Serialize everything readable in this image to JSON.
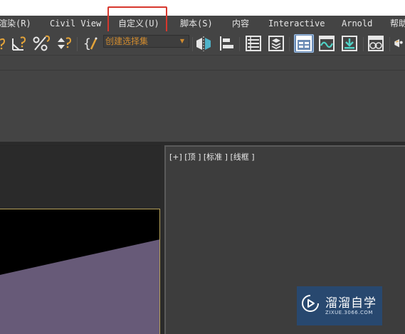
{
  "menubar": {
    "items": [
      {
        "label": "渲染(R)"
      },
      {
        "label": "Civil View"
      },
      {
        "label": "自定义(U)"
      },
      {
        "label": "脚本(S)"
      },
      {
        "label": "内容"
      },
      {
        "label": "Interactive"
      },
      {
        "label": "Arnold"
      },
      {
        "label": "帮助"
      }
    ],
    "highlighted": "自定义(U)",
    "highlight_color": "#d7372d"
  },
  "toolbar": {
    "selection_set_placeholder": "创建选择集",
    "selection_set_text_color": "#d08b2f",
    "icons": [
      "snap-toggle-icon",
      "angle-snap-icon",
      "percent-snap-icon",
      "spinner-snap-icon",
      "edit-named-selection-icon",
      "mirror-icon",
      "align-icon",
      "scene-explorer-icon",
      "layer-explorer-icon",
      "toggle-ribbon-icon",
      "curve-editor-icon",
      "schematic-view-icon",
      "material-editor-icon",
      "render-setup-icon"
    ]
  },
  "viewport": {
    "right_label": "[+] [顶 ] [标准 ] [线框 ]",
    "object_color": "#675a78",
    "frame_color": "#b7a25a"
  },
  "watermark": {
    "title": "溜溜自学",
    "url": "ZIXUE.3066.COM",
    "bg_color": "#234b7d"
  }
}
